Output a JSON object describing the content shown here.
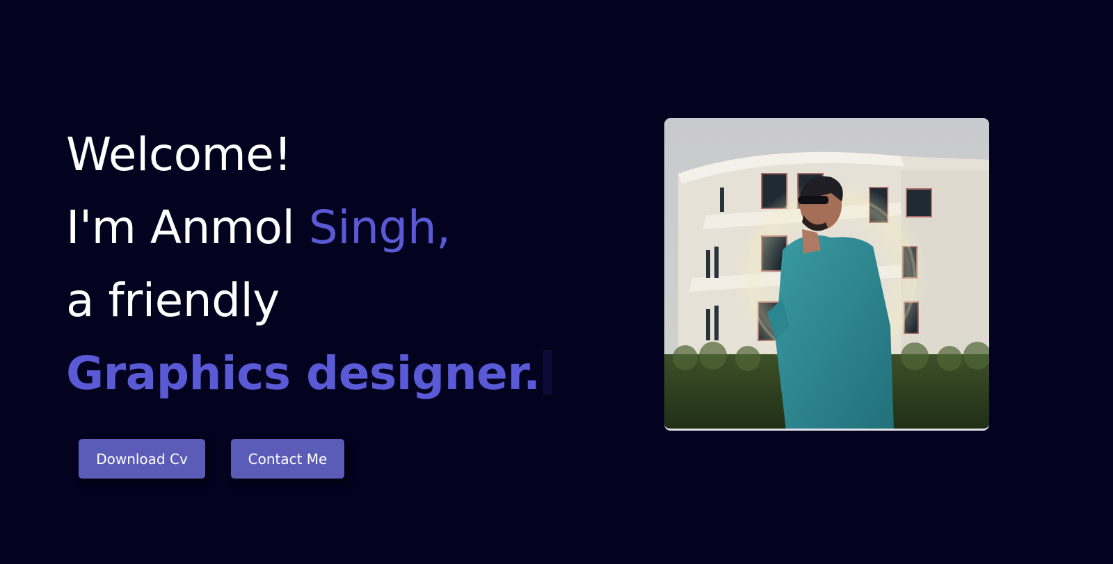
{
  "hero": {
    "line1": "Welcome!",
    "line2_start": "I'm Anmol ",
    "line2_accent": "Singh,",
    "line3": "a friendly",
    "line4": "Graphics designer."
  },
  "buttons": {
    "download_cv": "Download Cv",
    "contact_me": "Contact Me"
  },
  "colors": {
    "background": "#03021f",
    "accent": "#5a5ad6",
    "button": "#5b5cb8",
    "text": "#ffffff"
  }
}
